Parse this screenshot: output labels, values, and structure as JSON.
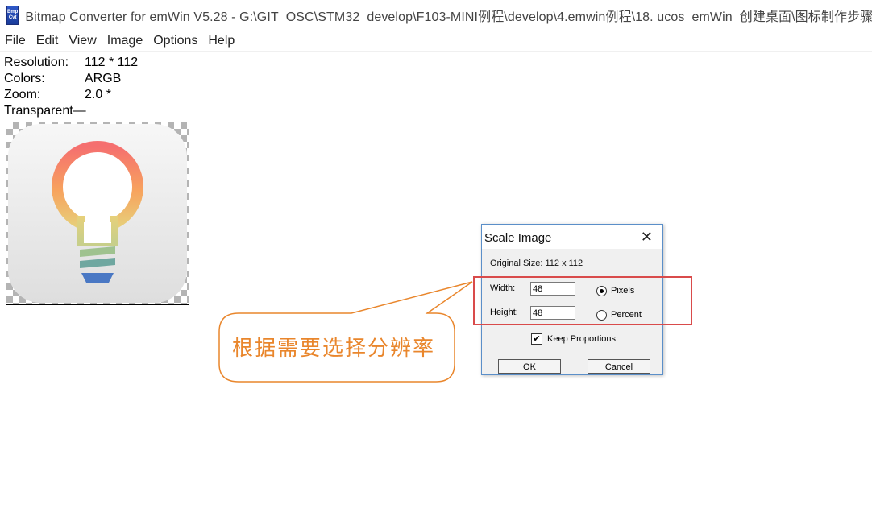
{
  "window": {
    "title": "Bitmap Converter for emWin V5.28 - G:\\GIT_OSC\\STM32_develop\\F103-MINI例程\\develop\\4.emwin例程\\18. ucos_emWin_创建桌面\\图标制作步骤\\转",
    "icon_text_top": "Bmp",
    "icon_text_bottom": "Cvt"
  },
  "menu": [
    "File",
    "Edit",
    "View",
    "Image",
    "Options",
    "Help"
  ],
  "info": {
    "resolution_label": "Resolution:",
    "resolution_value": "112 * 112",
    "colors_label": "Colors:",
    "colors_value": "ARGB",
    "zoom_label": "Zoom:",
    "zoom_value": "2.0 *",
    "transparent_label": "Transparent—"
  },
  "annotation": {
    "text": "根据需要选择分辨率",
    "color": "#e9862c",
    "highlight_color": "#d94b4b"
  },
  "dialog": {
    "title": "Scale Image",
    "original_size": "Original Size: 112 x 112",
    "width_label": "Width:",
    "width_value": "48",
    "height_label": "Height:",
    "height_value": "48",
    "unit_pixels": "Pixels",
    "unit_percent": "Percent",
    "selected_unit": "Pixels",
    "keep_proportions": "Keep Proportions:",
    "keep_proportions_checked": true,
    "ok_label": "OK",
    "cancel_label": "Cancel"
  }
}
